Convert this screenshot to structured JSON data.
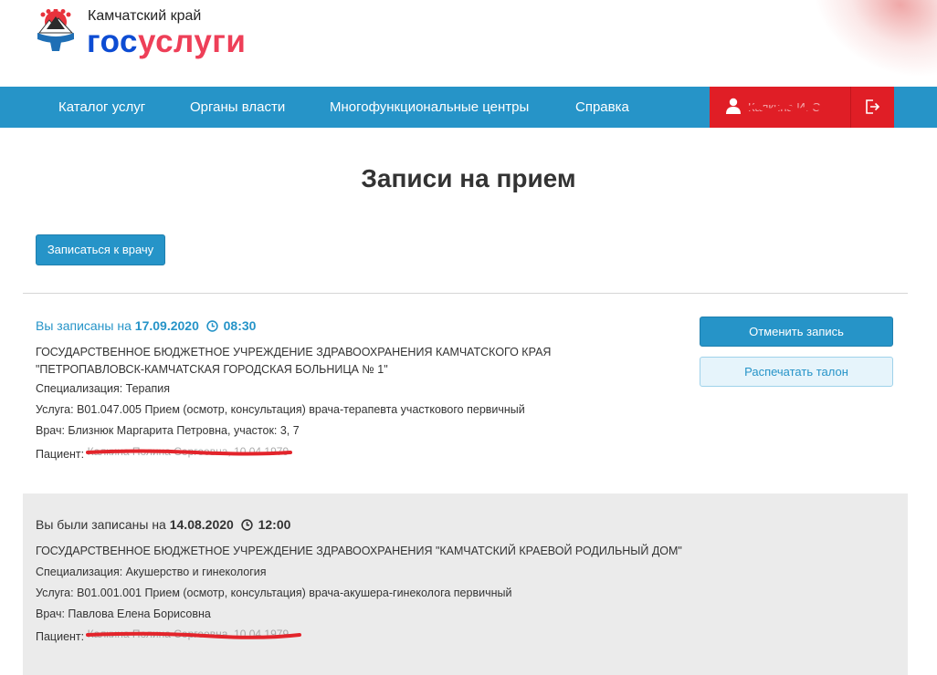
{
  "header": {
    "region": "Камчатский край",
    "brand_part1": "гос",
    "brand_part2": "услуги"
  },
  "nav": {
    "items": [
      "Каталог услуг",
      "Органы власти",
      "Многофункциональные центры",
      "Справка"
    ],
    "user_name": "Калкина И. С.",
    "colors": {
      "nav_bg": "#2694c8",
      "user_bg": "#e01e26"
    }
  },
  "page": {
    "title": "Записи на прием",
    "book_button": "Записаться к врачу"
  },
  "appointments": [
    {
      "lead": "Вы записаны на",
      "date": "17.09.2020",
      "time": "08:30",
      "organization": "ГОСУДАРСТВЕННОЕ БЮДЖЕТНОЕ УЧРЕЖДЕНИЕ ЗДРАВООХРАНЕНИЯ КАМЧАТСКОГО КРАЯ \"ПЕТРОПАВЛОВСК-КАМЧАТСКАЯ ГОРОДСКАЯ БОЛЬНИЦА № 1\"",
      "specialization": "Специализация: Терапия",
      "service": "Услуга: B01.047.005 Прием (осмотр, консультация) врача-терапевта участкового первичный",
      "doctor": "Врач: Близнюк Маргарита Петровна, участок: 3, 7",
      "patient_label": "Пациент:",
      "patient_value": "Калкина Полина Сергеевна, 10.04.1979",
      "cancel_button": "Отменить запись",
      "print_button": "Распечатать талон"
    },
    {
      "lead": "Вы были записаны на",
      "date": "14.08.2020",
      "time": "12:00",
      "organization": "ГОСУДАРСТВЕННОЕ БЮДЖЕТНОЕ УЧРЕЖДЕНИЕ ЗДРАВООХРАНЕНИЯ \"КАМЧАТСКИЙ КРАЕВОЙ РОДИЛЬНЫЙ ДОМ\"",
      "specialization": "Специализация: Акушерство и гинекология",
      "service": "Услуга: B01.001.001 Прием (осмотр, консультация) врача-акушера-гинеколога первичный",
      "doctor": "Врач: Павлова Елена Борисовна",
      "patient_label": "Пациент:",
      "patient_value": "Калкина Полина Сергеевна, 10.04.1979"
    }
  ]
}
